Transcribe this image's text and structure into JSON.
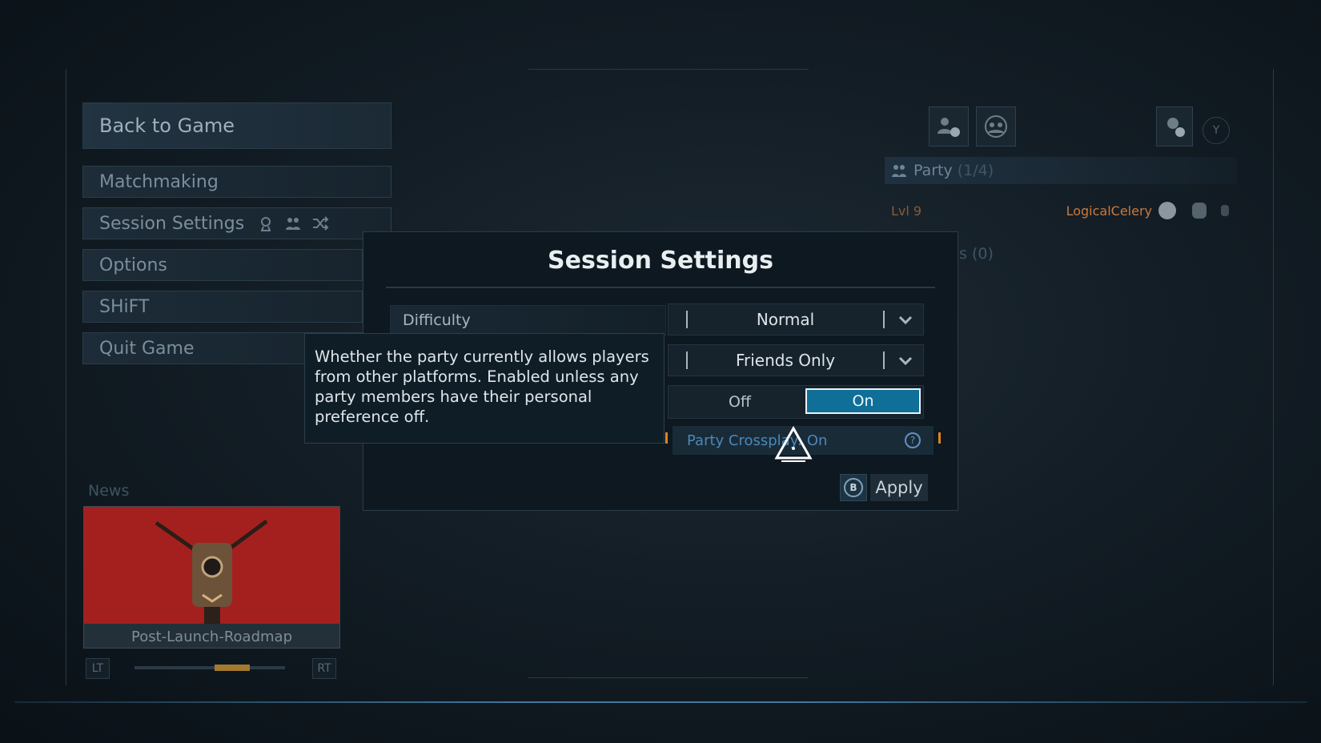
{
  "menu": {
    "back_to_game": "Back to Game",
    "items": [
      {
        "label": "Matchmaking"
      },
      {
        "label": "Session Settings",
        "icons": [
          "difficulty-icon",
          "party-icon",
          "crossplay-icon"
        ]
      },
      {
        "label": "Options"
      },
      {
        "label": "SHiFT"
      },
      {
        "label": "Quit Game"
      }
    ]
  },
  "news": {
    "label": "News",
    "card_caption": "Post-Launch-Roadmap",
    "left_key": "LT",
    "right_key": "RT"
  },
  "party": {
    "title": "Party",
    "count": "(1/4)",
    "member": {
      "level": "Lvl 9",
      "name": "LogicalCelery"
    },
    "second_section_fragment": "s (0)",
    "top_key": "Y"
  },
  "modal": {
    "title": "Session Settings",
    "rows": [
      {
        "label": "Difficulty",
        "value": "Normal"
      },
      {
        "label": "",
        "value": "Friends Only"
      }
    ],
    "toggle": {
      "off_label": "Off",
      "on_label": "On",
      "selected": "On"
    },
    "crossplay_row": {
      "label": "Party Crossplay: On",
      "visible_text": "Party Crossplay: On"
    },
    "apply_key": "B",
    "apply_label": "Apply"
  },
  "tooltip": {
    "text": "Whether the party currently allows players from other platforms. Enabled unless any party members have their personal preference off."
  },
  "colors": {
    "accent_blue": "#0f6f98",
    "level_orange": "#c97a3c",
    "news_red": "#a4201e"
  }
}
